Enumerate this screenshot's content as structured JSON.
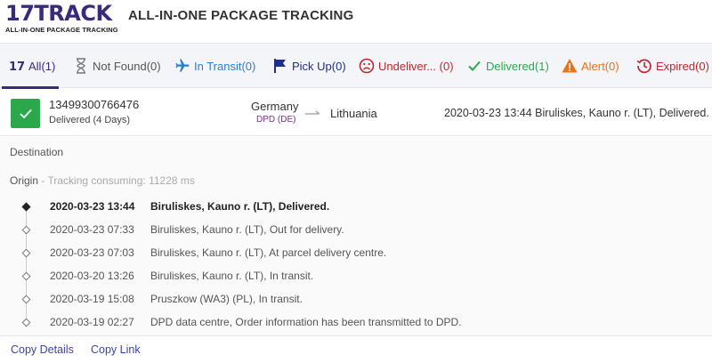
{
  "header": {
    "logo_main_17": "17",
    "logo_main_track": "TRACK",
    "logo_sub": "ALL-IN-ONE PACKAGE TRACKING",
    "title": "ALL-IN-ONE PACKAGE TRACKING"
  },
  "tabs": [
    {
      "label": "All(1)",
      "icon": "logo-17-icon",
      "color": "#3a2a7a"
    },
    {
      "label": "Not Found(0)",
      "icon": "hourglass-icon",
      "color": "#666666"
    },
    {
      "label": "In Transit(0)",
      "icon": "airplane-icon",
      "color": "#2b7fd1"
    },
    {
      "label": "Pick Up(0)",
      "icon": "flag-icon",
      "color": "#1f2e8a"
    },
    {
      "label": "Undeliver... (0)",
      "icon": "sad-face-icon",
      "color": "#c0272d"
    },
    {
      "label": "Delivered(1)",
      "icon": "checkmark-icon",
      "color": "#2aa84b"
    },
    {
      "label": "Alert(0)",
      "icon": "warning-triangle-icon",
      "color": "#e8731a"
    },
    {
      "label": "Expired(0)",
      "icon": "history-icon",
      "color": "#c0272d"
    }
  ],
  "shipment": {
    "tracking_number": "13499300766476",
    "status": "Delivered (4 Days)",
    "from_country": "Germany",
    "carrier": "DPD (DE)",
    "to_country": "Lithuania",
    "last_event": "2020-03-23 13:44  Biruliskes, Kauno r. (LT), Delivered."
  },
  "detail": {
    "destination_label": "Destination",
    "origin_label": "Origin",
    "origin_sep": " - ",
    "tracking_consuming": "Tracking consuming: 11228 ms",
    "events": [
      {
        "time": "2020-03-23 13:44",
        "desc": "Biruliskes, Kauno r. (LT), Delivered."
      },
      {
        "time": "2020-03-23 07:33",
        "desc": "Biruliskes, Kauno r. (LT), Out for delivery."
      },
      {
        "time": "2020-03-23 07:03",
        "desc": "Biruliskes, Kauno r. (LT), At parcel delivery centre."
      },
      {
        "time": "2020-03-20 13:26",
        "desc": "Biruliskes, Kauno r. (LT), In transit."
      },
      {
        "time": "2020-03-19 15:08",
        "desc": "Pruszkow (WA3) (PL), In transit."
      },
      {
        "time": "2020-03-19 02:27",
        "desc": "DPD data centre, Order information has been transmitted to DPD."
      }
    ]
  },
  "footer": {
    "copy_details": "Copy Details",
    "copy_link": "Copy Link"
  },
  "colors": {
    "brand": "#3a2a7a",
    "delivered": "#2aa84b",
    "link": "#3d43a8"
  }
}
